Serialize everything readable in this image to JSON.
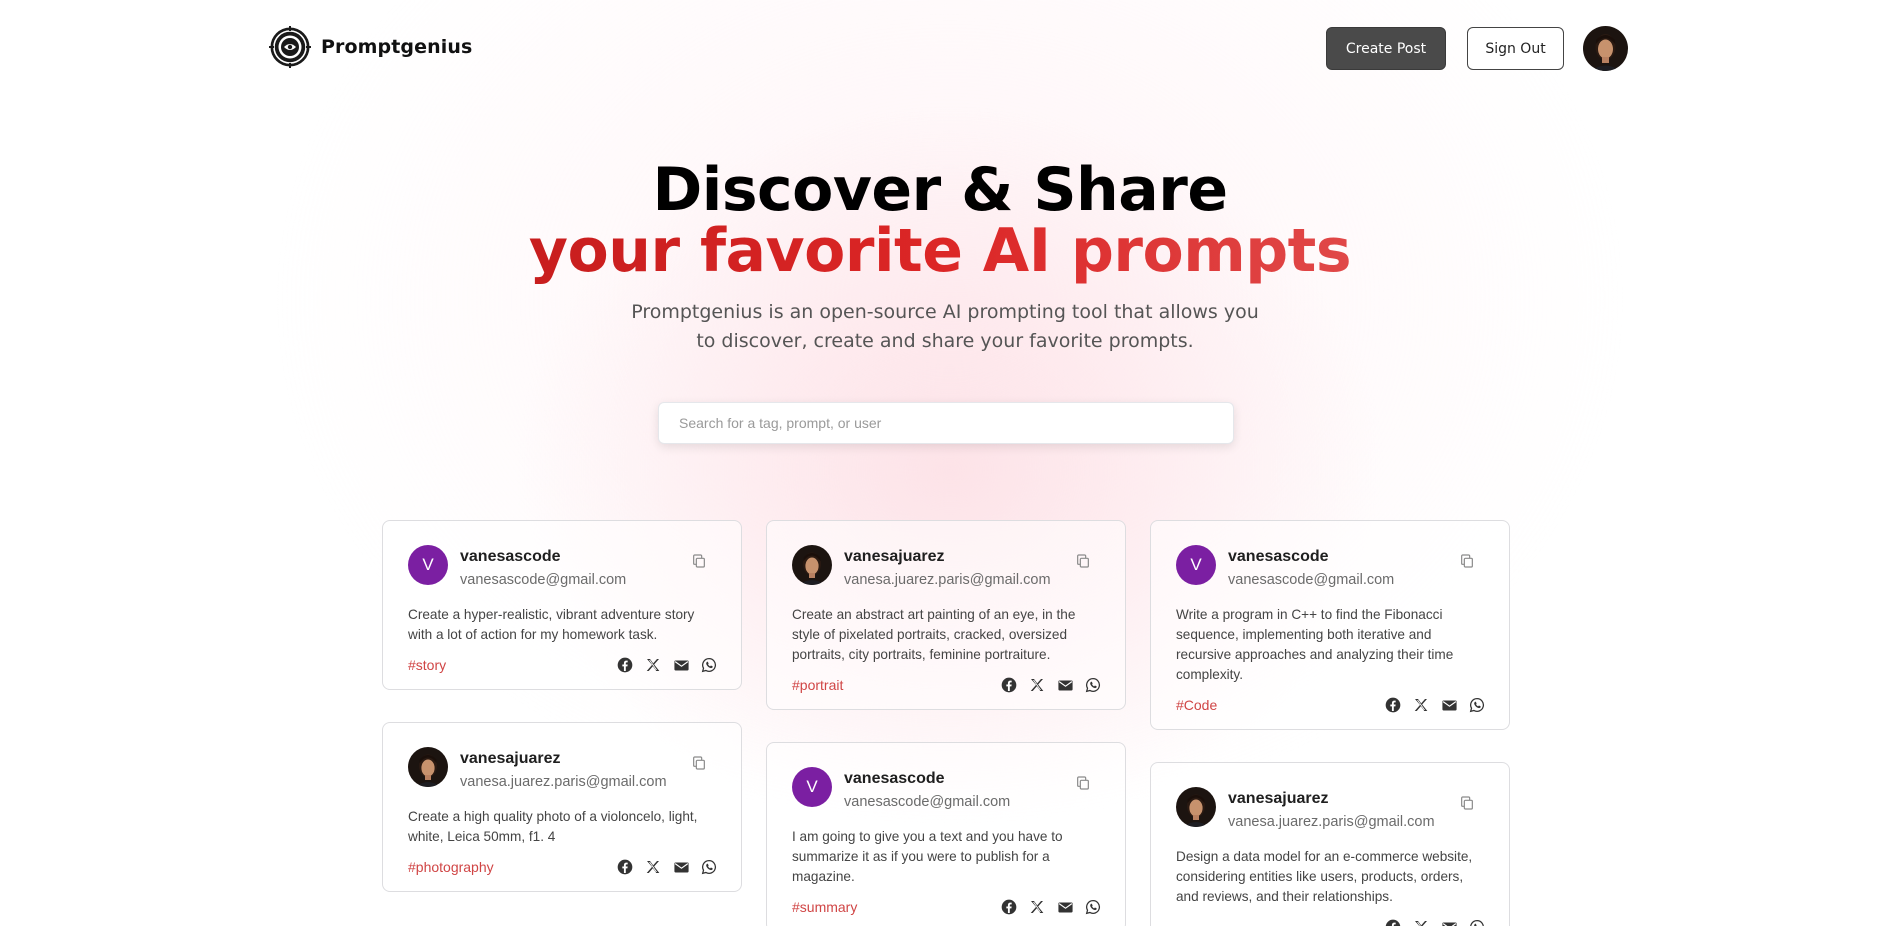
{
  "app": {
    "name": "Promptgenius",
    "colors": {
      "accent": "#dc2626",
      "primary_button": "#4a4a4a",
      "avatar_purple": "#7b1fa2"
    }
  },
  "nav": {
    "create_label": "Create Post",
    "signout_label": "Sign Out"
  },
  "hero": {
    "line1": "Discover & Share",
    "line2": "your favorite AI prompts",
    "description": "Promptgenius is an open-source AI prompting tool that allows you to discover, create and share your favorite prompts."
  },
  "search": {
    "placeholder": "Search for a tag, prompt, or user",
    "value": ""
  },
  "posts": [
    {
      "username": "vanesascode",
      "email": "vanesascode@gmail.com",
      "avatar": "letter",
      "avatar_letter": "V",
      "prompt": "Create a hyper-realistic, vibrant adventure story with a lot of action for my homework task.",
      "tag": "#story"
    },
    {
      "username": "vanesajuarez",
      "email": "vanesa.juarez.paris@gmail.com",
      "avatar": "photo",
      "prompt": "Create a high quality photo of a violoncelo, light, white, Leica 50mm, f1. 4",
      "tag": "#photography"
    },
    {
      "username": "vanesajuarez",
      "email": "vanesa.juarez.paris@gmail.com",
      "avatar": "photo",
      "prompt": "Create an abstract art painting of an eye, in the style of pixelated portraits, cracked, oversized portraits, city portraits, feminine portraiture.",
      "tag": "#portrait"
    },
    {
      "username": "vanesascode",
      "email": "vanesascode@gmail.com",
      "avatar": "letter",
      "avatar_letter": "V",
      "prompt": "I am going to give you a text and you have to summarize it as if you were to publish for a magazine.",
      "tag": "#summary"
    },
    {
      "username": "vanesascode",
      "email": "vanesascode@gmail.com",
      "avatar": "letter",
      "avatar_letter": "V",
      "prompt": "Write a program in C++ to find the Fibonacci sequence, implementing both iterative and recursive approaches and analyzing their time complexity.",
      "tag": "#Code"
    },
    {
      "username": "vanesajuarez",
      "email": "vanesa.juarez.paris@gmail.com",
      "avatar": "photo",
      "prompt": "Design a data model for an e-commerce website, considering entities like users, products, orders, and reviews, and their relationships.",
      "tag": ""
    }
  ],
  "icons": [
    "promptgenius-logo-icon",
    "copy-icon",
    "facebook-icon",
    "x-icon",
    "email-icon",
    "whatsapp-icon"
  ]
}
